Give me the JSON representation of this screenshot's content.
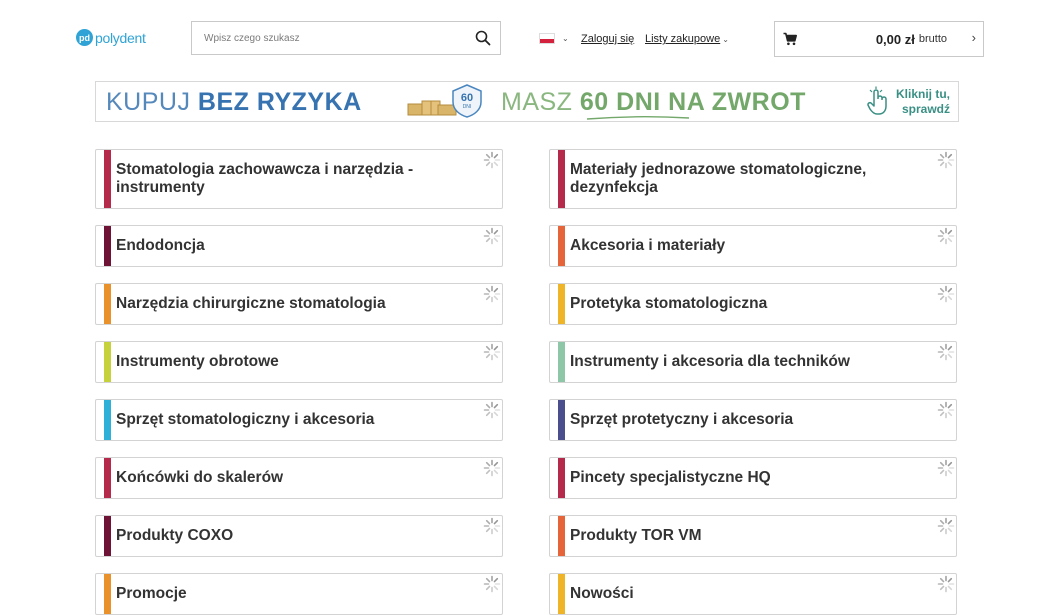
{
  "header": {
    "logo_mark": "pd",
    "logo_text": "polydent",
    "search_placeholder": "Wpisz czego szukasz",
    "login_label": "Zaloguj się",
    "lists_label": "Listy zakupowe",
    "cart_total": "0,00 zł",
    "cart_gross_label": "brutto",
    "flag_colors": [
      "#ffffff",
      "#d4213d"
    ]
  },
  "banner": {
    "text1_light": "KUPUJ ",
    "text1_bold": "BEZ RYZYKA",
    "badge_number": "60",
    "badge_unit": "DNI",
    "text2_light": "MASZ ",
    "text2_bold": "60 DNI NA ZWROT",
    "cta_line1": "Kliknij tu,",
    "cta_line2": "sprawdź"
  },
  "categories": [
    {
      "label": "Stomatologia zachowawcza i narzędzia - instrumenty",
      "color": "#b5294a"
    },
    {
      "label": "Materiały jednorazowe stomatologiczne, dezynfekcja",
      "color": "#b5294a"
    },
    {
      "label": "Endodoncja",
      "color": "#6e1236"
    },
    {
      "label": "Akcesoria i materiały",
      "color": "#e5643a"
    },
    {
      "label": "Narzędzia chirurgiczne stomatologia",
      "color": "#e9912b"
    },
    {
      "label": "Protetyka stomatologiczna",
      "color": "#f0b429"
    },
    {
      "label": "Instrumenty obrotowe",
      "color": "#c5d23b"
    },
    {
      "label": "Instrumenty i akcesoria dla techników",
      "color": "#8ec6a8"
    },
    {
      "label": "Sprzęt stomatologiczny i akcesoria",
      "color": "#2fb0d9"
    },
    {
      "label": "Sprzęt protetyczny i akcesoria",
      "color": "#4b4e8c"
    },
    {
      "label": "Końcówki do skalerów",
      "color": "#b5294a"
    },
    {
      "label": "Pincety specjalistyczne HQ",
      "color": "#b5294a"
    },
    {
      "label": "Produkty COXO",
      "color": "#6e1236"
    },
    {
      "label": "Produkty TOR VM",
      "color": "#e5643a"
    },
    {
      "label": "Promocje",
      "color": "#e9912b"
    },
    {
      "label": "Nowości",
      "color": "#f0b429"
    }
  ]
}
